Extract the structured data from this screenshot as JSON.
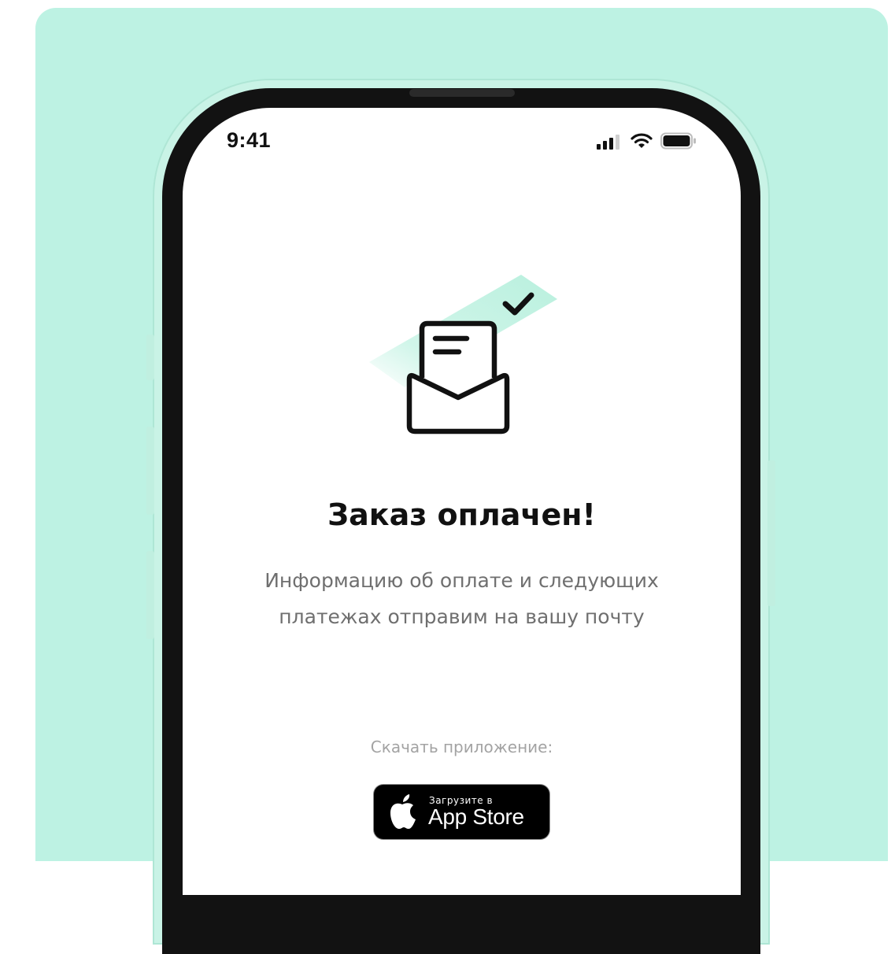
{
  "status_bar": {
    "time": "9:41",
    "signal_icon": "cellular-signal-icon",
    "wifi_icon": "wifi-icon",
    "battery_icon": "battery-icon"
  },
  "illustration": {
    "icon": "paid-envelope-icon",
    "check_icon": "checkmark-icon",
    "accent_color": "#c5f3e4"
  },
  "main": {
    "title": "Заказ оплачен!",
    "description": "Информацию об оплате и следующих платежах отправим на вашу почту",
    "download_label": "Скачать приложение:"
  },
  "app_store_button": {
    "small_label": "Загрузите в",
    "big_label": "App Store",
    "icon": "apple-icon"
  },
  "colors": {
    "background": "#bdf2e3",
    "phone_frame": "#121212",
    "screen": "#ffffff",
    "button": "#000000"
  }
}
